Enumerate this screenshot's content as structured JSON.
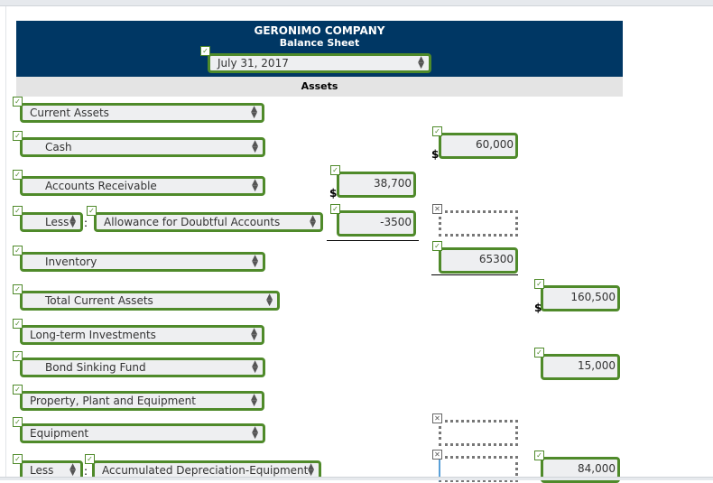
{
  "header": {
    "company": "GERONIMO COMPANY",
    "statement": "Balance Sheet",
    "date": "July 31, 2017",
    "section": "Assets"
  },
  "rows": {
    "current_assets": {
      "label": "Current Assets"
    },
    "cash": {
      "label": "Cash",
      "col2": "60,000",
      "currency": "$"
    },
    "accounts_receivable": {
      "label": "Accounts Receivable",
      "col1": "38,700",
      "currency": "$"
    },
    "allowance": {
      "prefix": "Less",
      "separator": ":",
      "label": "Allowance for Doubtful Accounts",
      "col1": "-3500",
      "col2": ""
    },
    "inventory": {
      "label": "Inventory",
      "col2": "65300"
    },
    "total_current_assets": {
      "label": "Total Current Assets",
      "col3": "160,500",
      "currency": "$"
    },
    "long_term_investments": {
      "label": "Long-term Investments"
    },
    "bond_sinking_fund": {
      "label": "Bond Sinking Fund",
      "col3": "15,000"
    },
    "ppe": {
      "label": "Property, Plant and Equipment"
    },
    "equipment": {
      "label": "Equipment",
      "col2": ""
    },
    "accum_depr": {
      "prefix": "Less",
      "separator": ":",
      "label": "Accumulated Depreciation-Equipment",
      "col2": "",
      "col3": "84,000"
    }
  },
  "marks": {
    "correct": "✓",
    "incorrect": "✕",
    "arrows_up": "▲",
    "arrows_down": "▼"
  }
}
